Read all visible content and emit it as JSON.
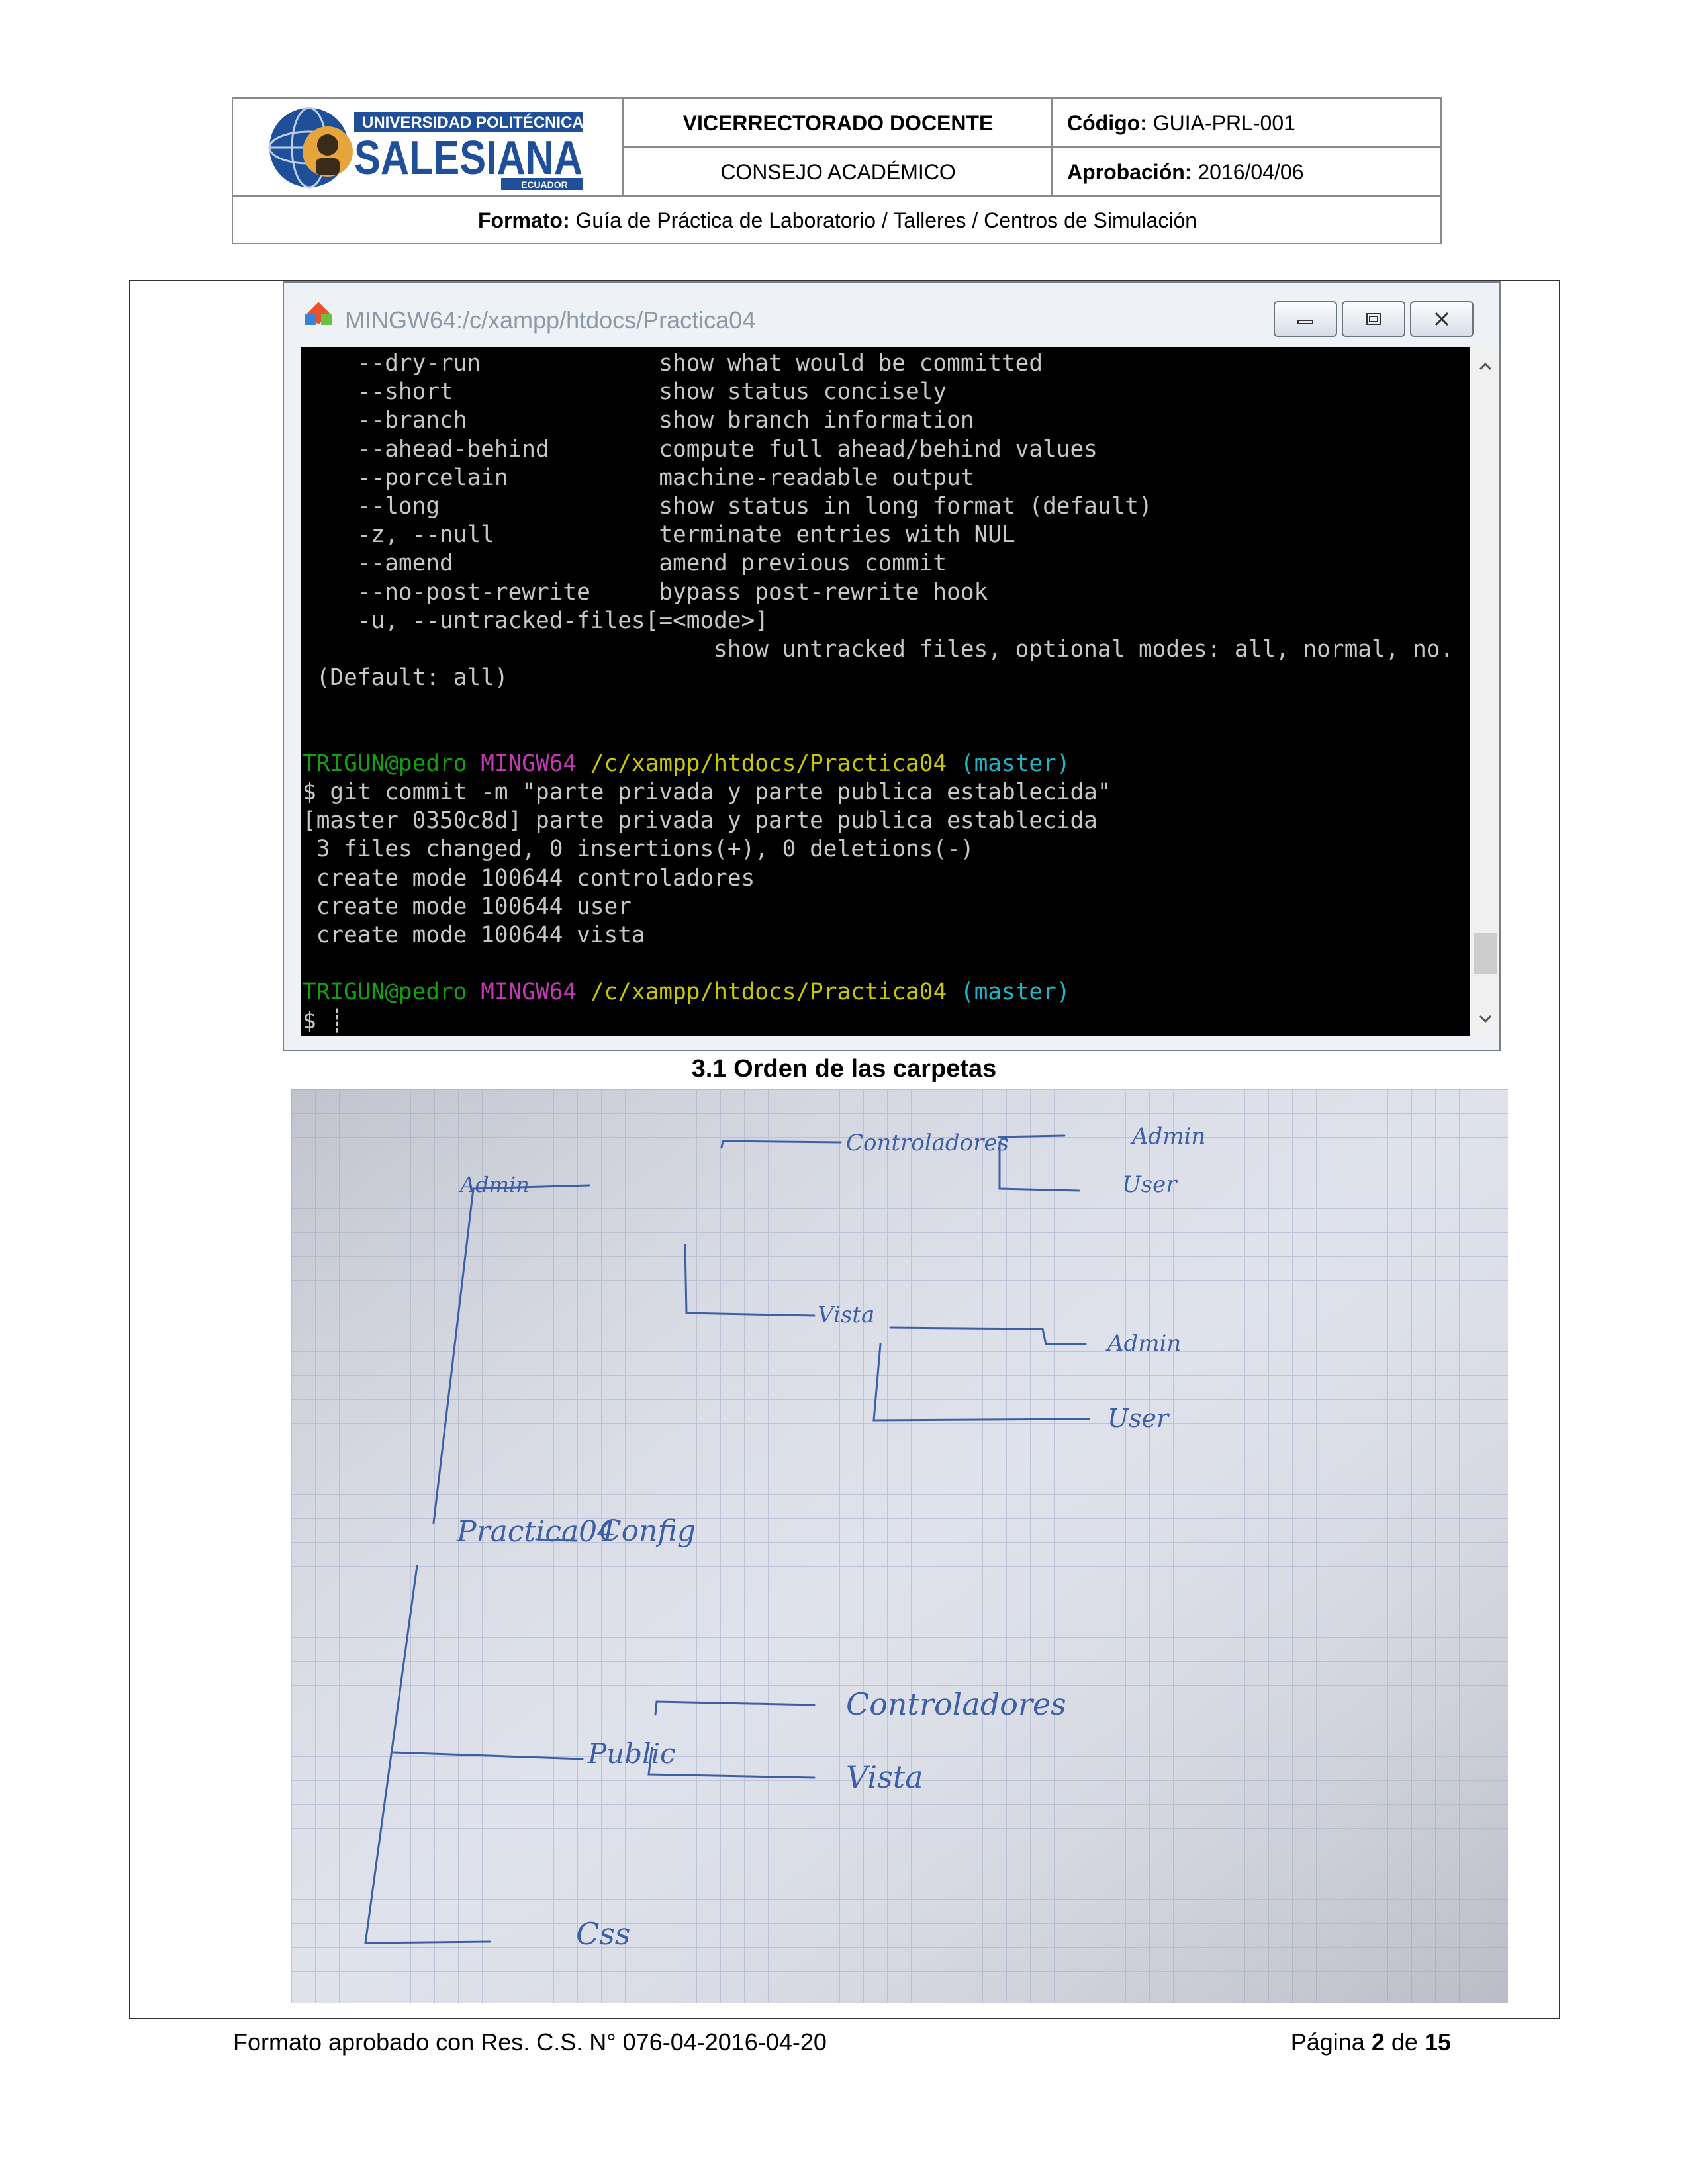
{
  "header": {
    "logo": {
      "line1": "UNIVERSIDAD POLITÉCNICA",
      "line2": "SALESIANA",
      "line3": "ECUADOR"
    },
    "department": "VICERRECTORADO DOCENTE",
    "council": "CONSEJO ACADÉMICO",
    "code_label": "Código:",
    "code_value": "GUIA-PRL-001",
    "approval_label": "Aprobación:",
    "approval_value": "2016/04/06",
    "format_label": "Formato:",
    "format_value": "Guía de Práctica de Laboratorio / Talleres / Centros de Simulación"
  },
  "terminal": {
    "title": "MINGW64:/c/xampp/htdocs/Practica04",
    "colors": {
      "green": "#13a10e",
      "magenta": "#c239b3",
      "yellow": "#c8c800",
      "cyan": "#1fb5c8",
      "text": "#c8c8c8"
    },
    "options": [
      {
        "flag": "    --dry-run",
        "desc": "show what would be committed"
      },
      {
        "flag": "    --short",
        "desc": "show status concisely"
      },
      {
        "flag": "    --branch",
        "desc": "show branch information"
      },
      {
        "flag": "    --ahead-behind",
        "desc": "compute full ahead/behind values"
      },
      {
        "flag": "    --porcelain",
        "desc": "machine-readable output"
      },
      {
        "flag": "    --long",
        "desc": "show status in long format (default)"
      },
      {
        "flag": "    -z, --null",
        "desc": "terminate entries with NUL"
      },
      {
        "flag": "    --amend",
        "desc": "amend previous commit"
      },
      {
        "flag": "    --no-post-rewrite",
        "desc": "bypass post-rewrite hook"
      }
    ],
    "untracked_flag": "    -u, --untracked-files[=<mode>]",
    "untracked_desc": "                              show untracked files, optional modes: all, normal, no.",
    "default_line": " (Default: all)",
    "prompt": {
      "user": "TRIGUN@pedro",
      "shell": "MINGW64",
      "path": "/c/xampp/htdocs/Practica04",
      "branch": "(master)"
    },
    "command": "$ git commit -m \"parte privada y parte publica establecida\"",
    "output": [
      "[master 0350c8d] parte privada y parte publica establecida",
      " 3 files changed, 0 insertions(+), 0 deletions(-)",
      " create mode 100644 controladores",
      " create mode 100644 user",
      " create mode 100644 vista"
    ],
    "last_prompt": "$ "
  },
  "caption": "3.1  Orden de las carpetas",
  "sketch": {
    "root": "Practica04",
    "config": "Config",
    "admin": "Admin",
    "controladores_top": "Controladores",
    "admin_ctrl": "Admin",
    "user_ctrl": "User",
    "vista_top": "Vista",
    "admin_vista": "Admin",
    "user_vista": "User",
    "public": "Public",
    "controladores_pub": "Controladores",
    "vista_pub": "Vista",
    "css": "Css"
  },
  "footer": {
    "left": "Formato aprobado con Res. C.S. N° 076-04-2016-04-20",
    "page_word": "Página",
    "page_num": "2",
    "of_word": "de",
    "page_total": "15"
  }
}
